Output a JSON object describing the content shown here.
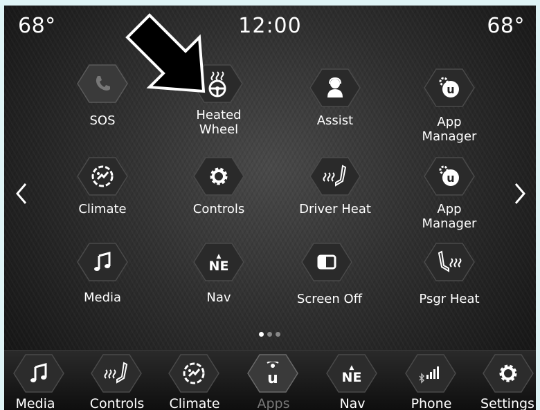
{
  "status": {
    "temp_left": "68°",
    "clock": "12:00",
    "temp_right": "68°"
  },
  "apps": [
    {
      "label": "SOS",
      "icon": "phone-icon",
      "dim": true
    },
    {
      "label": "Heated Wheel",
      "icon": "heated-wheel-icon"
    },
    {
      "label": "Assist",
      "icon": "assist-icon"
    },
    {
      "label": "App Manager",
      "icon": "app-manager-icon"
    },
    {
      "label": "Climate",
      "icon": "climate-icon"
    },
    {
      "label": "Controls",
      "icon": "gear-icon"
    },
    {
      "label": "Driver Heat",
      "icon": "seat-heat-icon"
    },
    {
      "label": "App Manager",
      "icon": "app-manager-icon"
    },
    {
      "label": "Media",
      "icon": "music-note-icon"
    },
    {
      "label": "Nav",
      "icon": "compass-ne-icon",
      "text": "NE"
    },
    {
      "label": "Screen Off",
      "icon": "screen-off-icon"
    },
    {
      "label": "Psgr Heat",
      "icon": "passenger-seat-heat-icon"
    }
  ],
  "pager": {
    "pages": 3,
    "current": 1
  },
  "dock": [
    {
      "label": "Media",
      "icon": "music-note-icon"
    },
    {
      "label": "Controls",
      "icon": "seat-heat-icon"
    },
    {
      "label": "Climate",
      "icon": "climate-icon"
    },
    {
      "label": "Apps",
      "icon": "uconnect-icon",
      "active": true
    },
    {
      "label": "Nav",
      "icon": "compass-ne-icon",
      "text": "NE"
    },
    {
      "label": "Phone",
      "icon": "phone-signal-icon"
    },
    {
      "label": "Settings",
      "icon": "gear-icon"
    }
  ]
}
